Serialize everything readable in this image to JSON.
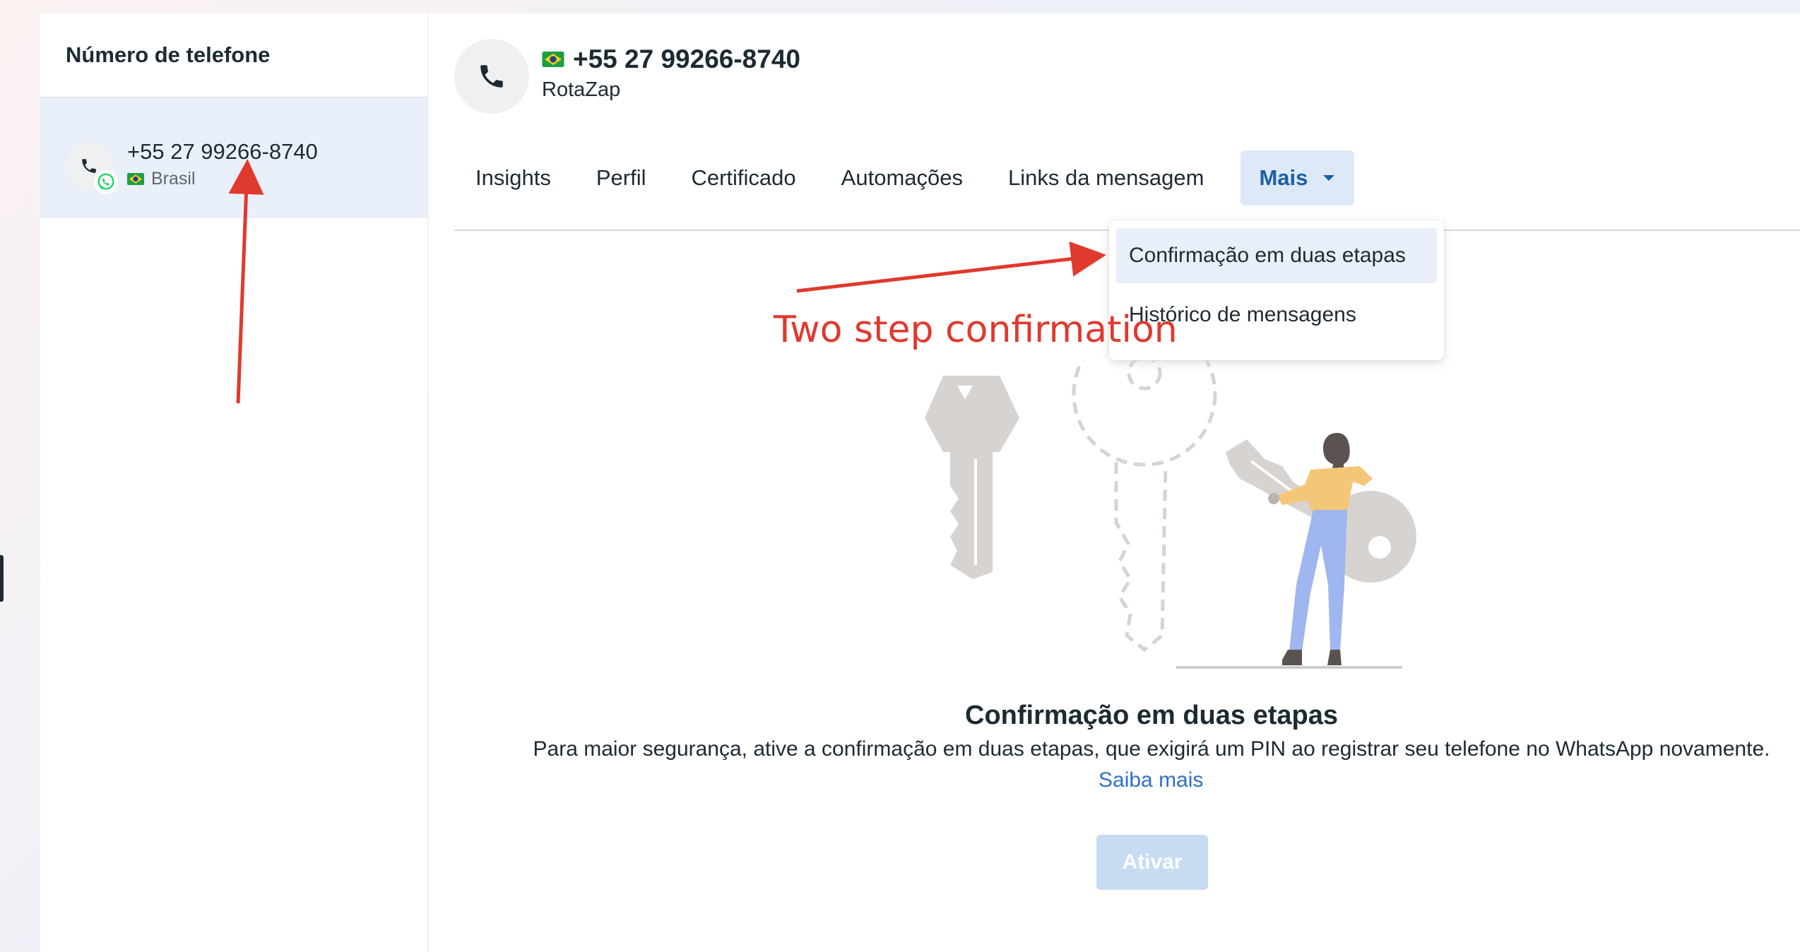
{
  "left": {
    "header_title": "Número de telefone",
    "items": [
      {
        "number": "+55 27 99266-8740",
        "country": "Brasil"
      }
    ]
  },
  "main": {
    "number": "+55 27 99266-8740",
    "name": "RotaZap",
    "tabs": [
      {
        "label": "Insights"
      },
      {
        "label": "Perfil"
      },
      {
        "label": "Certificado"
      },
      {
        "label": "Automações"
      },
      {
        "label": "Links da mensagem"
      },
      {
        "label": "Mais",
        "active": true
      }
    ],
    "dropdown": [
      {
        "label": "Confirmação em duas etapas",
        "highlighted": true
      },
      {
        "label": "Histórico de mensagens"
      }
    ],
    "section": {
      "title": "Confirmação em duas etapas",
      "description": "Para maior segurança, ative a confirmação em duas etapas, que exigirá um PIN ao registrar seu telefone no WhatsApp novamente.",
      "learn_more": "Saiba mais",
      "button": "Ativar"
    }
  },
  "annotation": {
    "text": "Two step confirmation"
  },
  "icons": [
    "phone-icon",
    "whatsapp-icon",
    "brazil-flag-icon",
    "chevron-down-icon",
    "keys-illustration"
  ],
  "colors": {
    "accent": "#1d5fa8",
    "link": "#2f72c2",
    "annotation": "#e0392d",
    "active_tab_bg": "#dde9f6",
    "disabled_button": "#c7dcf3"
  }
}
